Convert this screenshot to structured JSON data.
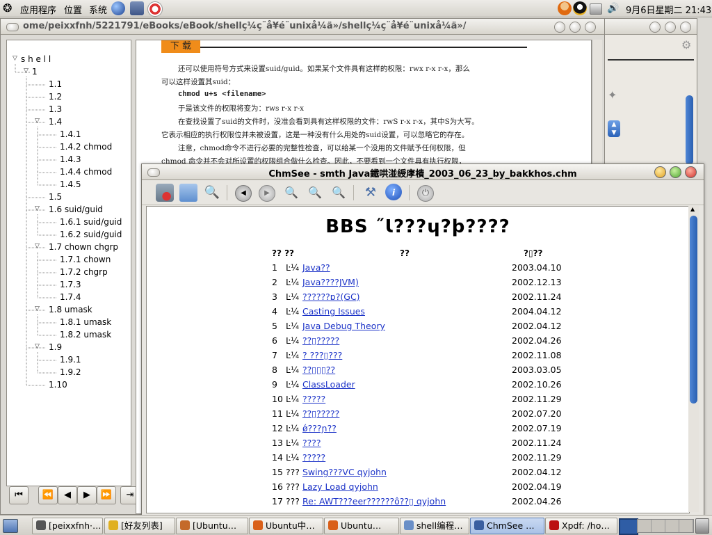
{
  "top_panel": {
    "menus": [
      "应用程序",
      "位置",
      "系统"
    ],
    "clock": "9月6日星期二 21:43",
    "icons": [
      "gnome-foot-icon",
      "globe-icon",
      "mail-icon",
      "help-lifebuoy-icon",
      "user-icon",
      "qq-penguin-icon",
      "printer-icon",
      "volume-icon"
    ]
  },
  "back_window": {
    "title": "ome/peixxfnh/5221791/eBooks/eBook/shellç¼ç¨å¥é¨unixå¼ä»/shellç¼ç¨å¥é¨unixå¼ä»/",
    "tree": [
      {
        "label": "s h e l l",
        "depth": 0,
        "open": true
      },
      {
        "label": "1",
        "depth": 1,
        "open": true
      },
      {
        "label": "1.1",
        "depth": 2
      },
      {
        "label": "1.2",
        "depth": 2
      },
      {
        "label": "1.3",
        "depth": 2
      },
      {
        "label": "1.4",
        "depth": 2,
        "open": true
      },
      {
        "label": "1.4.1",
        "depth": 3
      },
      {
        "label": "1.4.2 chmod",
        "depth": 3
      },
      {
        "label": "1.4.3",
        "depth": 3
      },
      {
        "label": "1.4.4 chmod",
        "depth": 3
      },
      {
        "label": "1.4.5",
        "depth": 3
      },
      {
        "label": "1.5",
        "depth": 2
      },
      {
        "label": "1.6 suid/guid",
        "depth": 2,
        "open": true
      },
      {
        "label": "1.6.1 suid/guid",
        "depth": 3
      },
      {
        "label": "1.6.2 suid/guid",
        "depth": 3
      },
      {
        "label": "1.7 chown chgrp",
        "depth": 2,
        "open": true
      },
      {
        "label": "1.7.1 chown",
        "depth": 3
      },
      {
        "label": "1.7.2 chgrp",
        "depth": 3
      },
      {
        "label": "1.7.3",
        "depth": 3
      },
      {
        "label": "1.7.4",
        "depth": 3
      },
      {
        "label": "1.8 umask",
        "depth": 2,
        "open": true
      },
      {
        "label": "1.8.1 umask",
        "depth": 3
      },
      {
        "label": "1.8.2 umask",
        "depth": 3
      },
      {
        "label": "1.9",
        "depth": 2,
        "open": true
      },
      {
        "label": "1.9.1",
        "depth": 3
      },
      {
        "label": "1.9.2",
        "depth": 3
      },
      {
        "label": "1.10",
        "depth": 2
      }
    ],
    "download_tag": "下 载",
    "doc_lines": [
      "还可以使用符号方式来设置suid/guid。如果某个文件具有这样的权限：rwx r-x r-x，那么",
      "可以这样设置其suid：",
      "chmod u+s <filename>",
      "于是该文件的权限将变为：rws r-x r-x",
      "在查找设置了suid的文件时，没准会看到具有这样权限的文件：rwS r-x r-x，其中S为大写。",
      "它表示相应的执行权限位并未被设置，这是一种没有什么用处的suid设置，可以忽略它的存在。",
      "注意，chmod命令不进行必要的完整性检查，可以给某一个没用的文件赋予任何权限，但",
      "chmod 命令并不会对所设置的权限组合做什么检查。因此，不要看到一个文件具有执行权限，"
    ]
  },
  "chm": {
    "title": "ChmSee - smth Java鐵哄湴綬庨樻_2003_06_23_by_bakkhos.chm",
    "page_title": "BBS ˝Ɩ???ɥ?þ????",
    "headers": {
      "num": "?? ??",
      "title": "??",
      "date": "?▯??"
    },
    "rows": [
      {
        "n": "1",
        "c": "Ŀ¼",
        "t": "Java?? ",
        "d": "2003.04.10"
      },
      {
        "n": "2",
        "c": "Ŀ¼",
        "t": "Java????JVM) ",
        "d": "2002.12.13"
      },
      {
        "n": "3",
        "c": "Ŀ¼",
        "t": "??????ɒ?(GC) ",
        "d": "2002.11.24"
      },
      {
        "n": "4",
        "c": "Ŀ¼",
        "t": "Casting Issues ",
        "d": "2004.04.12"
      },
      {
        "n": "5",
        "c": "Ŀ¼",
        "t": "Java Debug Theory ",
        "d": "2002.04.12"
      },
      {
        "n": "6",
        "c": "Ŀ¼",
        "t": "??▯????? ",
        "d": "2002.04.26"
      },
      {
        "n": "7",
        "c": "Ŀ¼",
        "t": "? ???▯??? ",
        "d": "2002.11.08"
      },
      {
        "n": "8",
        "c": "Ŀ¼",
        "t": "??▯▯▯?? ",
        "d": "2003.03.05"
      },
      {
        "n": "9",
        "c": "Ŀ¼",
        "t": "ClassLoader ",
        "d": "2002.10.26"
      },
      {
        "n": "10",
        "c": "Ŀ¼",
        "t": "????? ",
        "d": "2002.11.29"
      },
      {
        "n": "11",
        "c": "Ŀ¼",
        "t": "??▯????? ",
        "d": "2002.07.20"
      },
      {
        "n": "12",
        "c": "Ŀ¼",
        "t": "ǿ???ɲ?? ",
        "d": "2002.07.19"
      },
      {
        "n": "13",
        "c": "Ŀ¼",
        "t": "???? ",
        "d": "2002.11.24"
      },
      {
        "n": "14",
        "c": "Ŀ¼",
        "t": "????? ",
        "d": "2002.11.29"
      },
      {
        "n": "15",
        "c": "???",
        "t": "Swing???VC qyjohn ",
        "d": "2002.04.12"
      },
      {
        "n": "16",
        "c": "???",
        "t": "Lazy Load qyjohn ",
        "d": "2002.04.19"
      },
      {
        "n": "17",
        "c": "???",
        "t": "Re: AWT???eer??????ô??▯ qyjohn ",
        "d": "2002.04.26"
      }
    ]
  },
  "taskbar": {
    "tasks": [
      {
        "label": "[peixxfnh·…",
        "icon": "terminal-icon",
        "color": "#555"
      },
      {
        "label": "[好友列表]",
        "icon": "qq-icon",
        "color": "#e0b020"
      },
      {
        "label": "[Ubuntu…",
        "icon": "browser-icon",
        "color": "#c46a2a"
      },
      {
        "label": "Ubuntu中…",
        "icon": "firefox-icon",
        "color": "#d9601a"
      },
      {
        "label": "Ubuntu…",
        "icon": "firefox-icon",
        "color": "#d9601a"
      },
      {
        "label": "shell编程…",
        "icon": "document-icon",
        "color": "#6a8fc7"
      },
      {
        "label": "ChmSee …",
        "icon": "chm-icon",
        "color": "#3a5fa0",
        "active": true
      },
      {
        "label": "Xpdf: /ho…",
        "icon": "pdf-icon",
        "color": "#b11"
      }
    ]
  }
}
